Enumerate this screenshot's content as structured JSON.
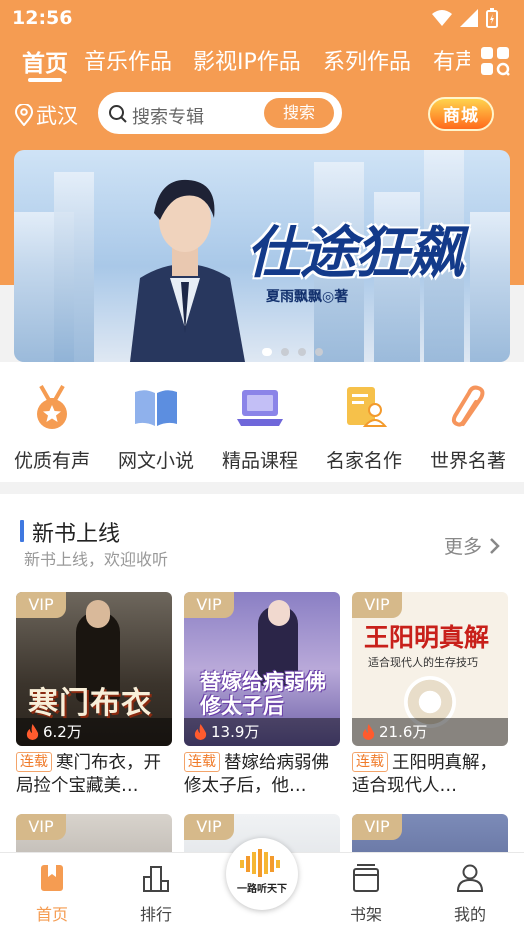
{
  "status": {
    "time": "12:56"
  },
  "tabs": [
    {
      "label": "首页",
      "active": true
    },
    {
      "label": "音乐作品"
    },
    {
      "label": "影视IP作品"
    },
    {
      "label": "系列作品"
    },
    {
      "label": "有声"
    }
  ],
  "location": "武汉",
  "search": {
    "placeholder": "搜索专辑",
    "button": "搜索"
  },
  "mall_label": "商城",
  "banner": {
    "title": "仕途狂飙",
    "author": "夏雨飘飘◎著",
    "page_count": 4,
    "active_index": 0
  },
  "categories": [
    {
      "label": "优质有声",
      "icon": "medal-icon"
    },
    {
      "label": "网文小说",
      "icon": "open-book-icon"
    },
    {
      "label": "精品课程",
      "icon": "laptop-icon"
    },
    {
      "label": "名家名作",
      "icon": "author-card-icon"
    },
    {
      "label": "世界名著",
      "icon": "paperclip-icon"
    }
  ],
  "section": {
    "title": "新书上线",
    "subtitle": "新书上线，欢迎收听",
    "more": "更多"
  },
  "books": [
    {
      "vip": "VIP",
      "plays": "6.2万",
      "serial": "连载",
      "title": "寒门布衣，开局捡个宝藏美…",
      "cover_text": "寒门布衣"
    },
    {
      "vip": "VIP",
      "plays": "13.9万",
      "serial": "连载",
      "title": "替嫁给病弱佛修太子后，他…",
      "cover_text": "替嫁给病弱佛修太子后"
    },
    {
      "vip": "VIP",
      "plays": "21.6万",
      "serial": "连载",
      "title": "王阳明真解，适合现代人…",
      "cover_text": "王阳明真解",
      "cover_sub": "适合现代人的生存技巧"
    },
    {
      "vip": "VIP"
    },
    {
      "vip": "VIP"
    },
    {
      "vip": "VIP"
    }
  ],
  "nav": [
    {
      "label": "首页",
      "icon": "bookmark-icon",
      "active": true
    },
    {
      "label": "排行",
      "icon": "bar-chart-icon"
    },
    {
      "label": "书架",
      "icon": "shelf-icon"
    },
    {
      "label": "我的",
      "icon": "user-icon"
    }
  ],
  "center_logo": "一路听天下",
  "colors": {
    "accent": "#f59c52",
    "serial": "#f07b2a",
    "section_bar": "#3f78e0"
  }
}
